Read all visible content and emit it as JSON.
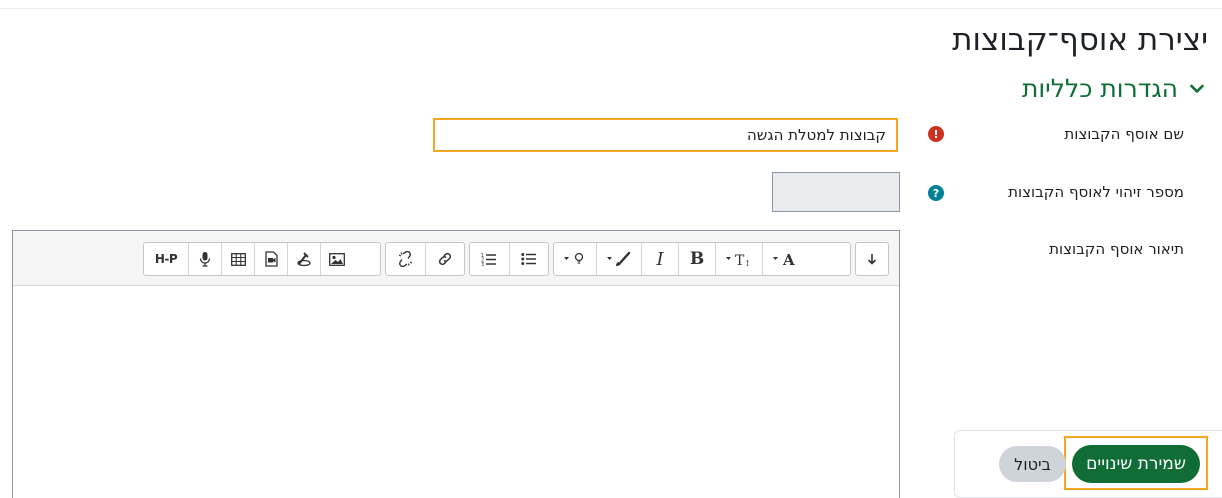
{
  "page": {
    "title": "יצירת אוסף־קבוצות"
  },
  "section": {
    "title": "הגדרות כלליות",
    "expanded": true
  },
  "fields": {
    "name": {
      "label": "שם אוסף הקבוצות",
      "value": "קבוצות למטלת הגשה",
      "status_icon": "required-icon"
    },
    "idnumber": {
      "label": "מספר זיהוי לאוסף הקבוצות",
      "value": "",
      "status_icon": "help-icon"
    },
    "description": {
      "label": "תיאור אוסף הקבוצות"
    }
  },
  "toolbar": {
    "icons": [
      "collapse-toolbar-icon",
      "font-size-icon",
      "font-family-icon",
      "bold-icon",
      "italic-icon",
      "font-color-icon",
      "background-color-icon",
      "unordered-list-icon",
      "ordered-list-icon",
      "link-icon",
      "unlink-icon",
      "image-icon",
      "media-icon",
      "manage-files-icon",
      "table-icon",
      "record-audio-icon",
      "h5p-icon"
    ],
    "h5p_label": "H-P"
  },
  "buttons": {
    "save": "שמירת שינויים",
    "cancel": "ביטול"
  },
  "colors": {
    "brand": "#0f6d35",
    "required": "#ca3120",
    "help": "#008196",
    "highlight": "#f5a623"
  }
}
